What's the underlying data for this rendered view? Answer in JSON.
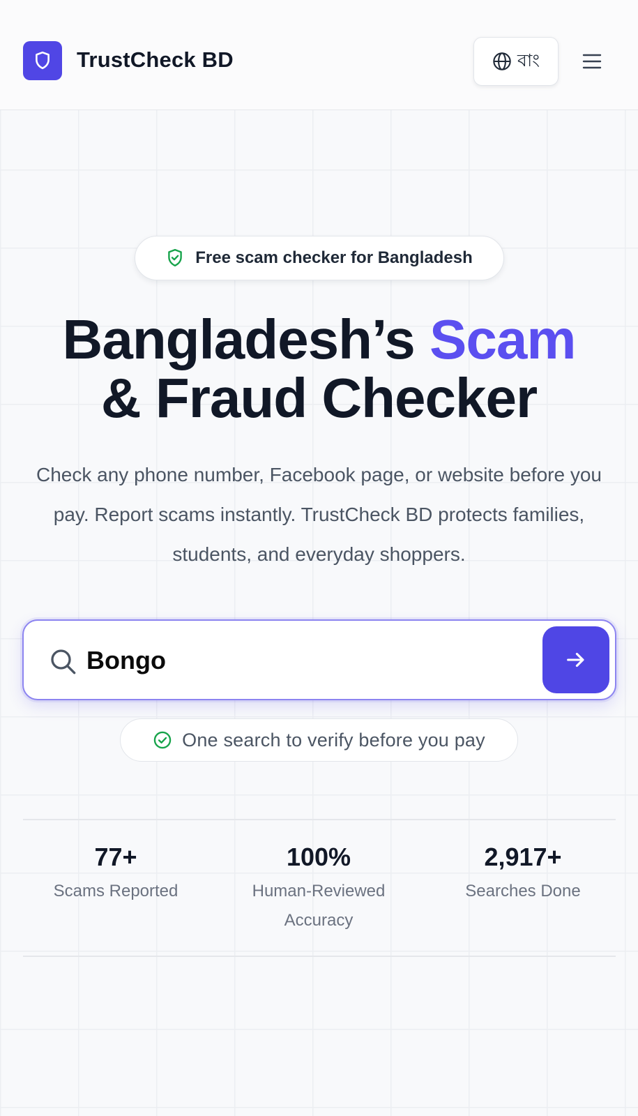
{
  "header": {
    "brand": "TrustCheck BD",
    "language_label": "বাং"
  },
  "badge": {
    "label": "Free scam checker for Bangladesh"
  },
  "hero": {
    "title_part1": "Bangladesh’s ",
    "title_accent": "Scam",
    "title_part2": "& Fraud Checker",
    "subtitle": "Check any phone number, Facebook page, or website before you pay. Report scams instantly. TrustCheck BD protects families, students, and everyday shoppers."
  },
  "search": {
    "value": "Bongo",
    "placeholder": ""
  },
  "verify_pill": {
    "label": "One search to verify before you pay"
  },
  "stats": [
    {
      "value": "77+",
      "label": "Scams Reported"
    },
    {
      "value": "100%",
      "label": "Human-Reviewed Accuracy"
    },
    {
      "value": "2,917+",
      "label": "Searches Done"
    }
  ],
  "colors": {
    "brand": "#5046e5",
    "accent": "#5b4ff0",
    "success": "#16a34a"
  },
  "icons": [
    "shield-icon",
    "globe-icon",
    "hamburger-menu-icon",
    "shield-check-icon",
    "search-icon",
    "arrow-right-icon",
    "check-circle-icon"
  ]
}
